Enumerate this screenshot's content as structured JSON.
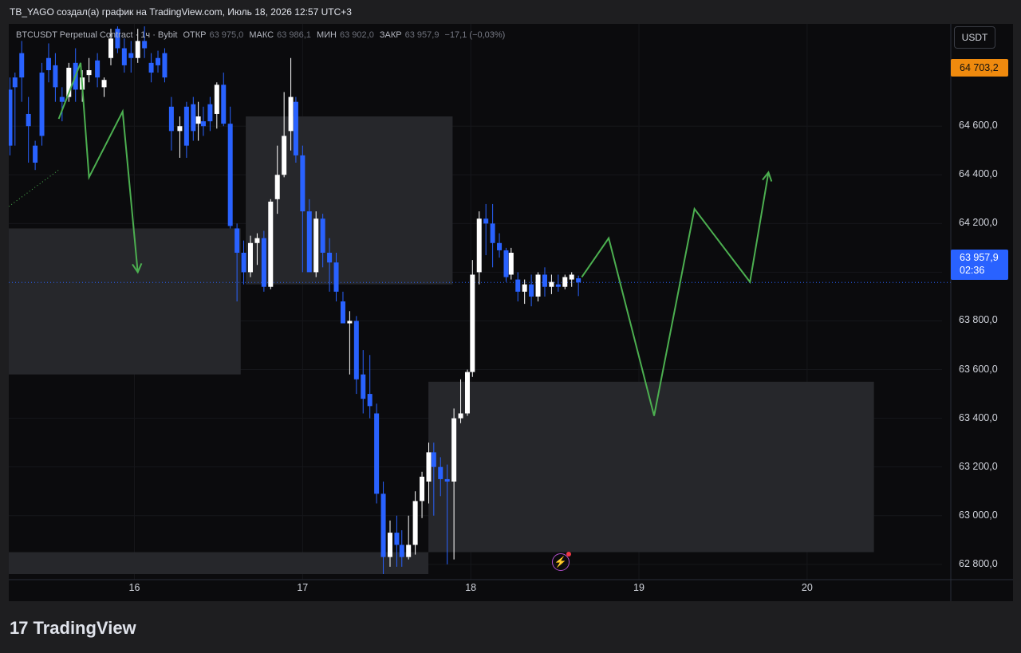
{
  "credit": "TB_YAGO создал(а) график на TradingView.com, Июль 18, 2026 12:57 UTC+3",
  "legend": {
    "symbol": "BTCUSDT Perpetual Contract · 1ч · Bybit",
    "open_label": "ОТКР",
    "open_value": "63 975,0",
    "high_label": "МАКС",
    "high_value": "63 986,1",
    "low_label": "МИН",
    "low_value": "63 902,0",
    "close_label": "ЗАКР",
    "close_value": "63 957,9",
    "change": "−17,1 (−0,03%)"
  },
  "currency_button": "USDT",
  "price_tags": {
    "high": "64 703,2",
    "last": "63 957,9",
    "countdown": "02:36"
  },
  "brand": {
    "logo": "17",
    "name": "TradingView"
  },
  "colors": {
    "background": "#0b0b0d",
    "up_candle": "#ffffff",
    "down_candle": "#2962ff",
    "zone": "#26272b",
    "projection": "#4caf50",
    "last_price_line": "#2962ff"
  },
  "chart_data": {
    "type": "candlestick",
    "y_axis_labels": [
      "64 600,0",
      "64 400,0",
      "64 200,0",
      "64 000,0",
      "63 800,0",
      "63 600,0",
      "63 400,0",
      "63 200,0",
      "63 000,0",
      "62 800,0"
    ],
    "y_ticks": [
      64600,
      64400,
      64200,
      64000,
      63800,
      63600,
      63400,
      63200,
      63000,
      62800
    ],
    "ylim": [
      62760,
      65020
    ],
    "x_axis_labels": [
      "16",
      "17",
      "18",
      "19",
      "20"
    ],
    "x_ticks": [
      16,
      17,
      18,
      19,
      20
    ],
    "xlim": [
      15.253,
      20.802
    ],
    "grid": true,
    "last_price": 63957.9,
    "candles": [
      [
        15.26,
        64750,
        64800,
        64480,
        64520
      ],
      [
        15.29,
        64800,
        64820,
        64520,
        64760
      ],
      [
        15.33,
        64900,
        64950,
        64700,
        64800
      ],
      [
        15.37,
        64650,
        64720,
        64450,
        64600
      ],
      [
        15.41,
        64520,
        64540,
        64420,
        64450
      ],
      [
        15.45,
        64820,
        64860,
        64520,
        64560
      ],
      [
        15.49,
        64880,
        64940,
        64780,
        64830
      ],
      [
        15.53,
        64850,
        64900,
        64700,
        64760
      ],
      [
        15.57,
        64720,
        64760,
        64620,
        64700
      ],
      [
        15.61,
        64720,
        64860,
        64700,
        64840
      ],
      [
        15.65,
        64860,
        64920,
        64700,
        64750
      ],
      [
        15.69,
        64750,
        64830,
        64700,
        64800
      ],
      [
        15.73,
        64810,
        64880,
        64780,
        64830
      ],
      [
        15.78,
        64870,
        64900,
        64760,
        64800
      ],
      [
        15.82,
        64760,
        64800,
        64720,
        64790
      ],
      [
        15.86,
        64880,
        65000,
        64850,
        64960
      ],
      [
        15.9,
        65000,
        65010,
        64900,
        64920
      ],
      [
        15.94,
        64920,
        64960,
        64820,
        64850
      ],
      [
        15.98,
        64900,
        64950,
        64820,
        64880
      ],
      [
        16.02,
        64880,
        65000,
        64860,
        64950
      ],
      [
        16.06,
        64950,
        65010,
        64880,
        64920
      ],
      [
        16.1,
        64860,
        64900,
        64780,
        64820
      ],
      [
        16.14,
        64880,
        64910,
        64820,
        64850
      ],
      [
        16.18,
        64900,
        64920,
        64780,
        64800
      ],
      [
        16.22,
        64680,
        64720,
        64500,
        64580
      ],
      [
        16.27,
        64580,
        64640,
        64470,
        64600
      ],
      [
        16.31,
        64680,
        64700,
        64470,
        64520
      ],
      [
        16.35,
        64690,
        64720,
        64540,
        64580
      ],
      [
        16.38,
        64610,
        64700,
        64540,
        64640
      ],
      [
        16.41,
        64620,
        64680,
        64560,
        64600
      ],
      [
        16.45,
        64690,
        64720,
        64580,
        64620
      ],
      [
        16.49,
        64650,
        64780,
        64590,
        64770
      ],
      [
        16.53,
        64770,
        64820,
        64600,
        64610
      ],
      [
        16.57,
        64610,
        64680,
        64180,
        64190
      ],
      [
        16.61,
        64180,
        64200,
        63880,
        64080
      ],
      [
        16.65,
        64080,
        64130,
        63950,
        64000
      ],
      [
        16.69,
        64000,
        64150,
        63980,
        64120
      ],
      [
        16.73,
        64120,
        64160,
        64030,
        64140
      ],
      [
        16.77,
        64140,
        64170,
        63920,
        63940
      ],
      [
        16.81,
        63940,
        64300,
        63930,
        64290
      ],
      [
        16.85,
        64300,
        64520,
        64240,
        64400
      ],
      [
        16.89,
        64400,
        64740,
        64390,
        64560
      ],
      [
        16.93,
        64580,
        64880,
        64500,
        64720
      ],
      [
        16.96,
        64700,
        64720,
        64450,
        64480
      ],
      [
        17.0,
        64480,
        64520,
        64000,
        64250
      ],
      [
        17.04,
        64250,
        64300,
        64100,
        64000
      ],
      [
        17.08,
        64000,
        64250,
        63980,
        64220
      ],
      [
        17.12,
        64220,
        64240,
        64020,
        64080
      ],
      [
        17.16,
        64080,
        64140,
        63920,
        64040
      ],
      [
        17.2,
        64040,
        64080,
        63880,
        63920
      ],
      [
        17.24,
        63880,
        63920,
        63820,
        63790
      ],
      [
        17.28,
        63790,
        63840,
        63580,
        63800
      ],
      [
        17.32,
        63800,
        63820,
        63500,
        63560
      ],
      [
        17.36,
        63580,
        63680,
        63420,
        63480
      ],
      [
        17.4,
        63500,
        63660,
        63400,
        63450
      ],
      [
        17.44,
        63420,
        63460,
        63050,
        63090
      ],
      [
        17.48,
        63090,
        63140,
        62760,
        62830
      ],
      [
        17.52,
        62830,
        62980,
        62790,
        62930
      ],
      [
        17.56,
        62930,
        63000,
        62790,
        62880
      ],
      [
        17.59,
        62880,
        62940,
        62790,
        62830
      ],
      [
        17.63,
        62830,
        63000,
        62820,
        62880
      ],
      [
        17.67,
        62880,
        63100,
        62840,
        63060
      ],
      [
        17.71,
        63060,
        63180,
        62990,
        63160
      ],
      [
        17.75,
        63140,
        63300,
        63050,
        63260
      ],
      [
        17.78,
        63260,
        63300,
        63000,
        63200
      ],
      [
        17.82,
        63200,
        63240,
        63080,
        63150
      ],
      [
        17.86,
        63150,
        63210,
        62800,
        63140
      ],
      [
        17.9,
        63140,
        63440,
        62820,
        63400
      ],
      [
        17.94,
        63400,
        63560,
        63380,
        63420
      ],
      [
        17.98,
        63420,
        63600,
        63410,
        63590
      ],
      [
        18.01,
        63590,
        64050,
        63570,
        63990
      ],
      [
        18.05,
        64000,
        64250,
        63950,
        64220
      ],
      [
        18.09,
        64220,
        64280,
        64070,
        64200
      ],
      [
        18.13,
        64200,
        64280,
        64020,
        64120
      ],
      [
        18.17,
        64120,
        64160,
        64060,
        64090
      ],
      [
        18.21,
        64090,
        64100,
        63960,
        63980
      ],
      [
        18.24,
        63990,
        64100,
        63970,
        64080
      ],
      [
        18.28,
        63970,
        64000,
        63880,
        63920
      ],
      [
        18.32,
        63920,
        63970,
        63870,
        63950
      ],
      [
        18.36,
        63950,
        63990,
        63860,
        63900
      ],
      [
        18.4,
        63900,
        64000,
        63880,
        63990
      ],
      [
        18.44,
        63990,
        64020,
        63900,
        63940
      ],
      [
        18.48,
        63940,
        63990,
        63910,
        63960
      ],
      [
        18.52,
        63950,
        63990,
        63920,
        63940
      ],
      [
        18.56,
        63940,
        63990,
        63930,
        63980
      ],
      [
        18.6,
        63970,
        64000,
        63940,
        63990
      ],
      [
        18.64,
        63975,
        63986.1,
        63902,
        63957.9
      ]
    ],
    "zones": [
      {
        "x": [
          15.253,
          16.632
        ],
        "y": [
          63580,
          64180
        ]
      },
      {
        "x": [
          16.662,
          17.892
        ],
        "y": [
          63950,
          64640
        ]
      },
      {
        "x": [
          15.253,
          17.748
        ],
        "y": [
          62760,
          62850
        ]
      },
      {
        "x": [
          17.748,
          20.397
        ],
        "y": [
          62850,
          63550
        ]
      }
    ],
    "projection_paths": [
      {
        "x": [
          15.55,
          15.68,
          15.73,
          15.93,
          16.02
        ],
        "y": [
          64630,
          64860,
          64390,
          64660,
          64000
        ]
      },
      {
        "x": [
          18.66,
          18.82,
          19.09,
          19.33,
          19.66,
          19.77
        ],
        "y": [
          63980,
          64140,
          63410,
          64260,
          63960,
          64410
        ]
      }
    ],
    "dotted_trend": {
      "x": [
        15.253,
        15.55
      ],
      "y": [
        64270,
        64420
      ]
    }
  }
}
